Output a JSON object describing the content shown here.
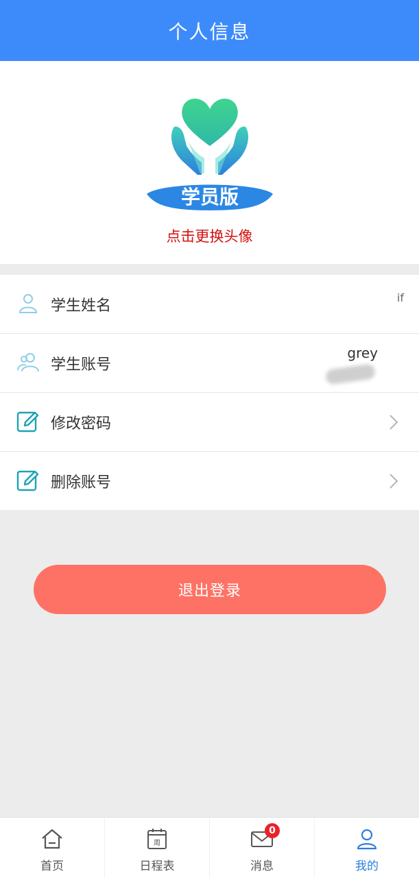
{
  "header": {
    "title": "个人信息"
  },
  "avatar": {
    "logo_text": "学员版",
    "change_label": "点击更换头像"
  },
  "rows": [
    {
      "label": "学生姓名",
      "value": "if",
      "icon": "user-icon"
    },
    {
      "label": "学生账号",
      "value": "grey",
      "icon": "users-icon"
    },
    {
      "label": "修改密码",
      "value": "",
      "icon": "edit-icon"
    },
    {
      "label": "删除账号",
      "value": "",
      "icon": "edit-icon"
    }
  ],
  "logout": {
    "label": "退出登录"
  },
  "tabbar": {
    "items": [
      {
        "label": "首页",
        "icon": "home-icon"
      },
      {
        "label": "日程表",
        "icon": "calendar-icon",
        "icon_text": "周"
      },
      {
        "label": "消息",
        "icon": "mail-icon",
        "badge": "0"
      },
      {
        "label": "我的",
        "icon": "profile-icon",
        "active": true
      }
    ]
  },
  "colors": {
    "header": "#3d8bfb",
    "logout": "#fe7265",
    "active_tab": "#2a7dde",
    "badge": "#e8232b"
  }
}
